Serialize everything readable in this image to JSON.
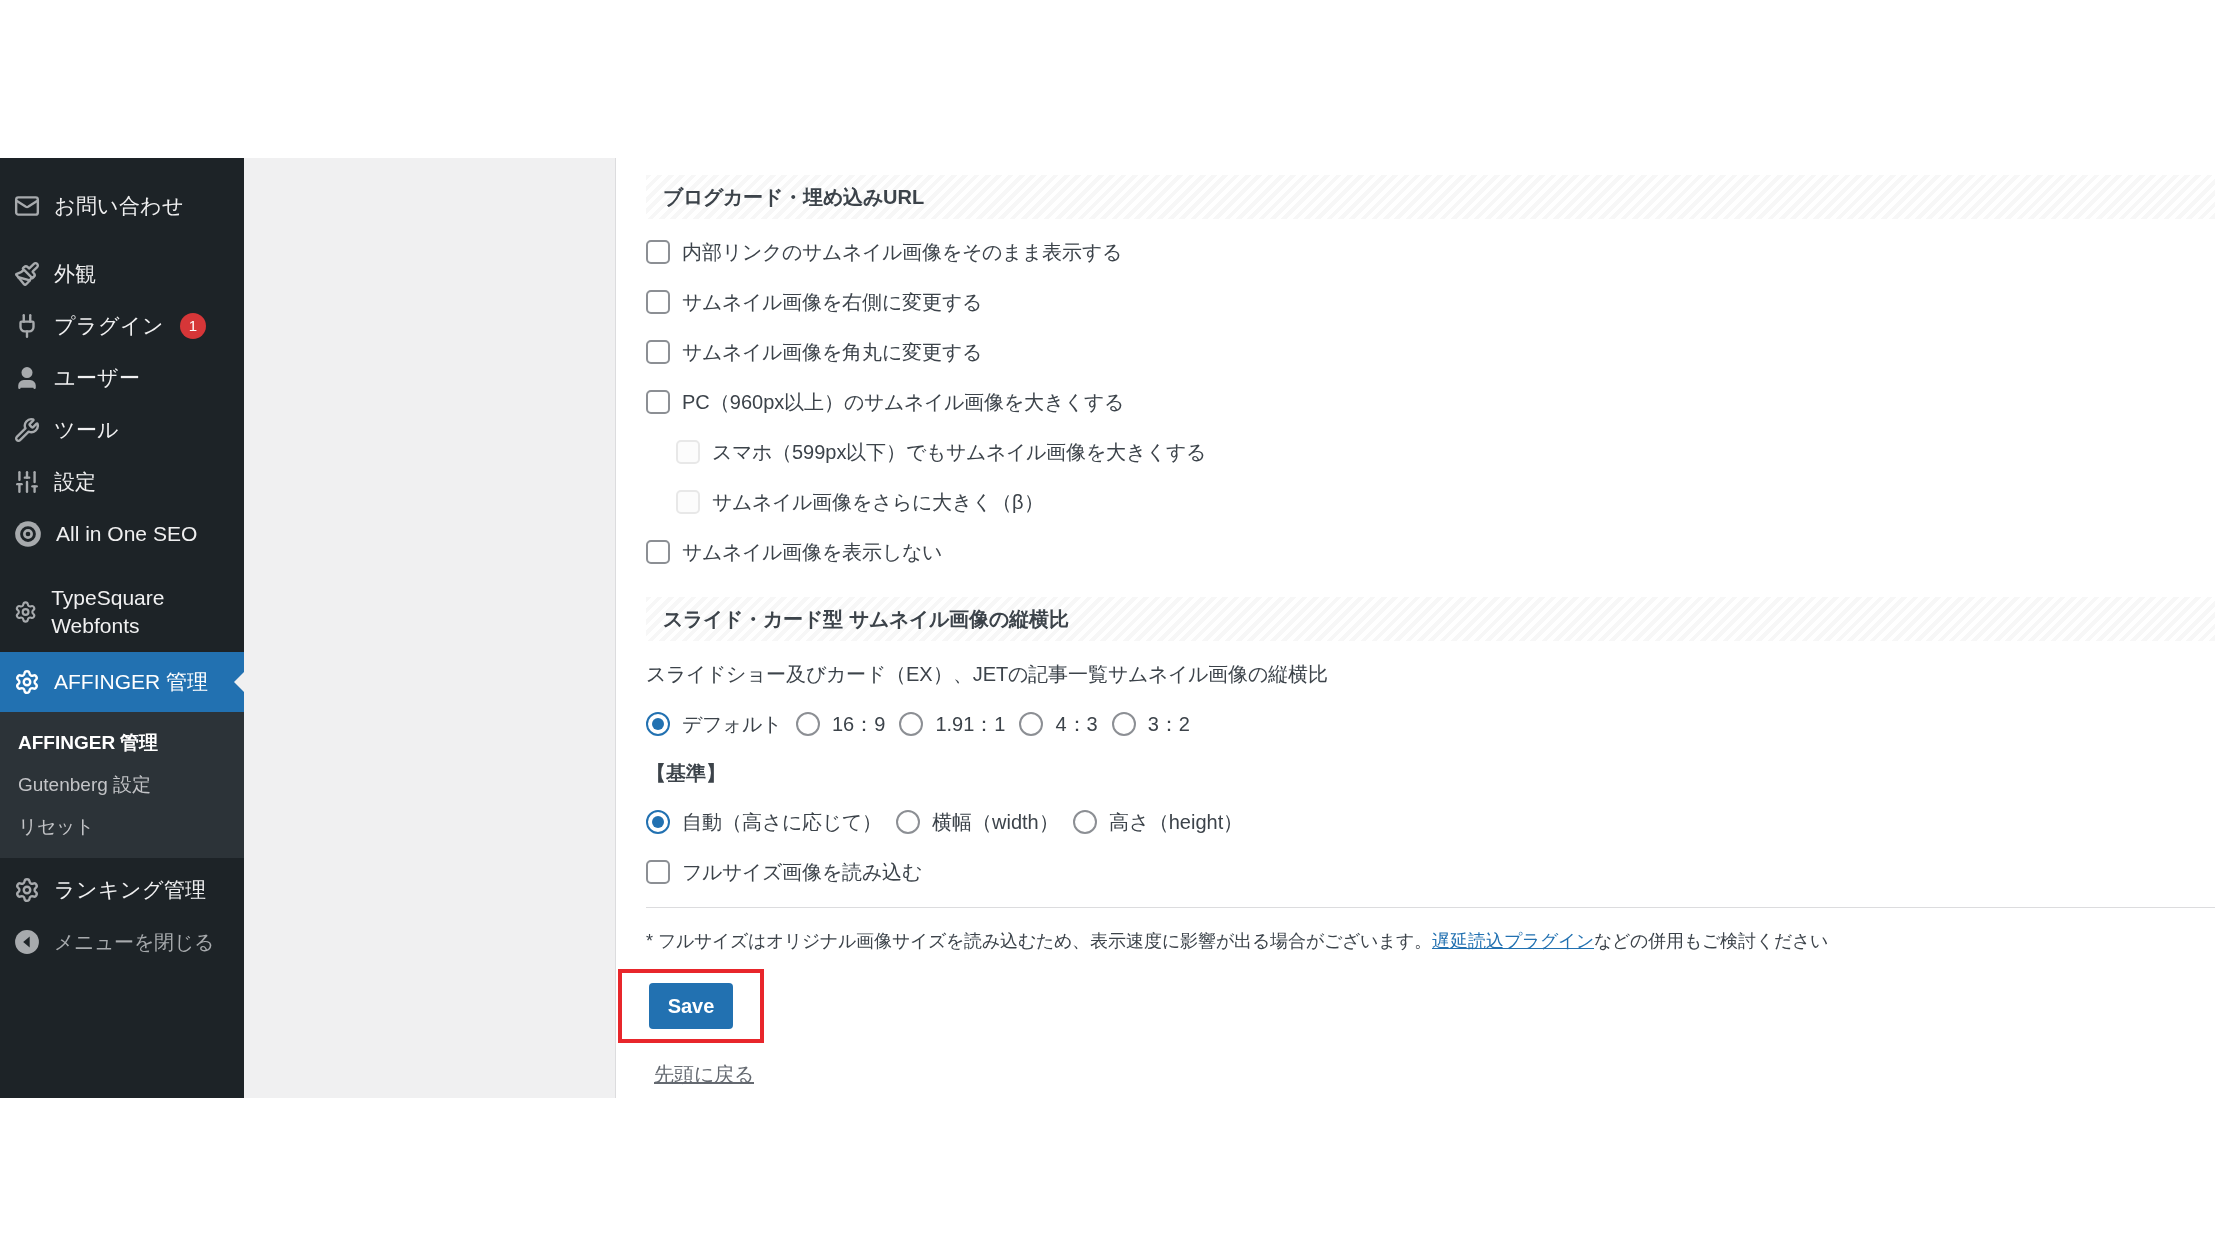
{
  "sidebar": {
    "items": [
      {
        "label": "お問い合わせ",
        "selected": false
      },
      {
        "label": "外観",
        "selected": false
      },
      {
        "label": "プラグイン",
        "selected": false,
        "badge": "1"
      },
      {
        "label": "ユーザー",
        "selected": false
      },
      {
        "label": "ツール",
        "selected": false
      },
      {
        "label": "設定",
        "selected": false
      },
      {
        "label": "All in One SEO",
        "selected": false
      },
      {
        "label": "TypeSquare Webfonts",
        "selected": false
      },
      {
        "label": "AFFINGER 管理",
        "selected": true,
        "children": [
          {
            "label": "AFFINGER 管理",
            "selected": true
          },
          {
            "label": "Gutenberg 設定",
            "selected": false
          },
          {
            "label": "リセット",
            "selected": false
          }
        ]
      },
      {
        "label": "ランキング管理",
        "selected": false
      }
    ],
    "collapse": "メニューを閉じる"
  },
  "sections": [
    {
      "title": "ブログカード・埋め込みURL",
      "rows": [
        {
          "kind": "checkbox",
          "label": "内部リンクのサムネイル画像をそのまま表示する",
          "checked": false,
          "disabled": false
        },
        {
          "kind": "checkbox",
          "label": "サムネイル画像を右側に変更する",
          "checked": false,
          "disabled": false
        },
        {
          "kind": "checkbox",
          "label": "サムネイル画像を角丸に変更する",
          "checked": false,
          "disabled": false
        },
        {
          "kind": "checkbox",
          "label": "PC（960px以上）のサムネイル画像を大きくする",
          "checked": false,
          "disabled": false,
          "children": [
            {
              "label": "スマホ（599px以下）でもサムネイル画像を大きくする",
              "checked": false,
              "disabled": true
            },
            {
              "label": "サムネイル画像をさらに大きく（β）",
              "checked": false,
              "disabled": true
            }
          ]
        },
        {
          "kind": "checkbox",
          "label": "サムネイル画像を表示しない",
          "checked": false,
          "disabled": false
        }
      ]
    },
    {
      "title": "スライド・カード型 サムネイル画像の縦横比",
      "rows": [
        {
          "kind": "text",
          "label": "スライドショー及びカード（EX）、JETの記事一覧サムネイル画像の縦横比"
        },
        {
          "kind": "radios",
          "options": [
            {
              "label": "デフォルト",
              "selected": true
            },
            {
              "label": "16：9",
              "selected": false
            },
            {
              "label": "1.91：1",
              "selected": false
            },
            {
              "label": "4：3",
              "selected": false
            },
            {
              "label": "3：2",
              "selected": false
            }
          ]
        },
        {
          "kind": "subheading",
          "label": "【基準】"
        },
        {
          "kind": "radios",
          "options": [
            {
              "label": "自動（高さに応じて）",
              "selected": true
            },
            {
              "label": "横幅（width）",
              "selected": false
            },
            {
              "label": "高さ（height）",
              "selected": false
            }
          ]
        },
        {
          "kind": "checkbox",
          "label": "フルサイズ画像を読み込む",
          "checked": false,
          "disabled": false
        }
      ]
    }
  ],
  "note": {
    "before": "* フルサイズはオリジナル画像サイズを読み込むため、表示速度に影響が出る場合がございます。",
    "link": "遅延読込プラグイン",
    "after": "などの併用もご検討ください"
  },
  "save_button": {
    "label": "Save",
    "highlighted": true
  },
  "back_link": "先頭に戻る"
}
